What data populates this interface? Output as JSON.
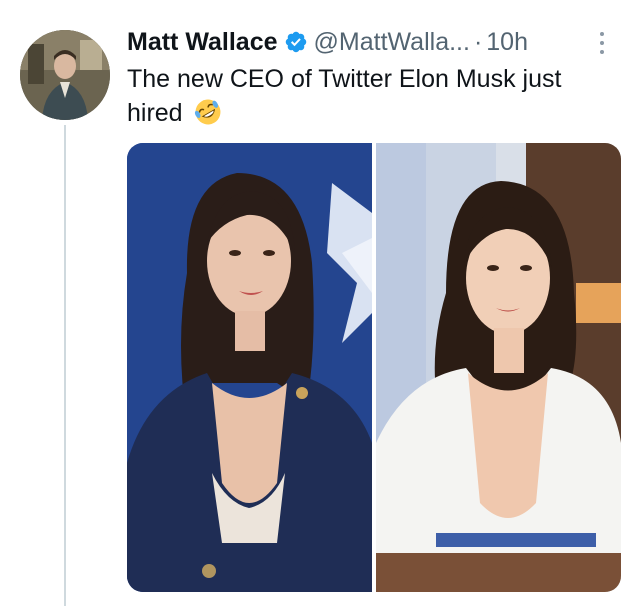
{
  "tweet": {
    "author_name": "Matt Wallace",
    "handle": "@MattWalla...",
    "separator": "·",
    "time": "10h",
    "text": "The new CEO of Twitter Elon Musk just hired",
    "emoji": "rolling-on-floor-laughing-emoji",
    "verified_color": "#1d9bf0"
  },
  "media": {
    "photos": [
      {
        "description_icon": "woman-in-navy-blazer-photo"
      },
      {
        "description_icon": "woman-in-white-dress-photo"
      }
    ]
  },
  "colors": {
    "text_primary": "#0f1419",
    "text_secondary": "#536471",
    "thread_line": "#cfd9de"
  }
}
